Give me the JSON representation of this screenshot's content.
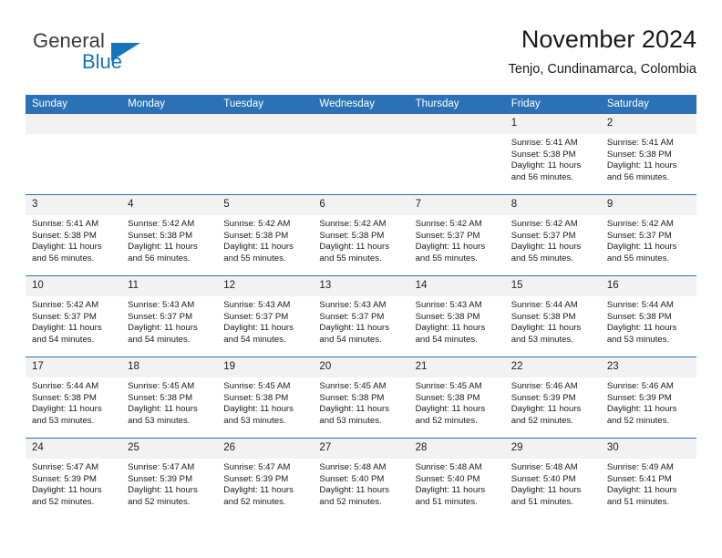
{
  "brand": {
    "name_top": "General",
    "name_bottom": "Blue",
    "triangle_color": "#1574bb"
  },
  "header": {
    "title": "November 2024",
    "subtitle": "Tenjo, Cundinamarca, Colombia"
  },
  "theme": {
    "header_blue": "#2a72b5",
    "daynum_gray": "#f2f2f2",
    "brand_blue": "#1574bb"
  },
  "calendar": {
    "weekday_headers": [
      "Sunday",
      "Monday",
      "Tuesday",
      "Wednesday",
      "Thursday",
      "Friday",
      "Saturday"
    ],
    "weeks": [
      [
        {
          "day": "",
          "blank": true
        },
        {
          "day": "",
          "blank": true
        },
        {
          "day": "",
          "blank": true
        },
        {
          "day": "",
          "blank": true
        },
        {
          "day": "",
          "blank": true
        },
        {
          "day": "1",
          "sunrise": "Sunrise: 5:41 AM",
          "sunset": "Sunset: 5:38 PM",
          "daylight": "Daylight: 11 hours and 56 minutes."
        },
        {
          "day": "2",
          "sunrise": "Sunrise: 5:41 AM",
          "sunset": "Sunset: 5:38 PM",
          "daylight": "Daylight: 11 hours and 56 minutes."
        }
      ],
      [
        {
          "day": "3",
          "sunrise": "Sunrise: 5:41 AM",
          "sunset": "Sunset: 5:38 PM",
          "daylight": "Daylight: 11 hours and 56 minutes."
        },
        {
          "day": "4",
          "sunrise": "Sunrise: 5:42 AM",
          "sunset": "Sunset: 5:38 PM",
          "daylight": "Daylight: 11 hours and 56 minutes."
        },
        {
          "day": "5",
          "sunrise": "Sunrise: 5:42 AM",
          "sunset": "Sunset: 5:38 PM",
          "daylight": "Daylight: 11 hours and 55 minutes."
        },
        {
          "day": "6",
          "sunrise": "Sunrise: 5:42 AM",
          "sunset": "Sunset: 5:38 PM",
          "daylight": "Daylight: 11 hours and 55 minutes."
        },
        {
          "day": "7",
          "sunrise": "Sunrise: 5:42 AM",
          "sunset": "Sunset: 5:37 PM",
          "daylight": "Daylight: 11 hours and 55 minutes."
        },
        {
          "day": "8",
          "sunrise": "Sunrise: 5:42 AM",
          "sunset": "Sunset: 5:37 PM",
          "daylight": "Daylight: 11 hours and 55 minutes."
        },
        {
          "day": "9",
          "sunrise": "Sunrise: 5:42 AM",
          "sunset": "Sunset: 5:37 PM",
          "daylight": "Daylight: 11 hours and 55 minutes."
        }
      ],
      [
        {
          "day": "10",
          "sunrise": "Sunrise: 5:42 AM",
          "sunset": "Sunset: 5:37 PM",
          "daylight": "Daylight: 11 hours and 54 minutes."
        },
        {
          "day": "11",
          "sunrise": "Sunrise: 5:43 AM",
          "sunset": "Sunset: 5:37 PM",
          "daylight": "Daylight: 11 hours and 54 minutes."
        },
        {
          "day": "12",
          "sunrise": "Sunrise: 5:43 AM",
          "sunset": "Sunset: 5:37 PM",
          "daylight": "Daylight: 11 hours and 54 minutes."
        },
        {
          "day": "13",
          "sunrise": "Sunrise: 5:43 AM",
          "sunset": "Sunset: 5:37 PM",
          "daylight": "Daylight: 11 hours and 54 minutes."
        },
        {
          "day": "14",
          "sunrise": "Sunrise: 5:43 AM",
          "sunset": "Sunset: 5:38 PM",
          "daylight": "Daylight: 11 hours and 54 minutes."
        },
        {
          "day": "15",
          "sunrise": "Sunrise: 5:44 AM",
          "sunset": "Sunset: 5:38 PM",
          "daylight": "Daylight: 11 hours and 53 minutes."
        },
        {
          "day": "16",
          "sunrise": "Sunrise: 5:44 AM",
          "sunset": "Sunset: 5:38 PM",
          "daylight": "Daylight: 11 hours and 53 minutes."
        }
      ],
      [
        {
          "day": "17",
          "sunrise": "Sunrise: 5:44 AM",
          "sunset": "Sunset: 5:38 PM",
          "daylight": "Daylight: 11 hours and 53 minutes."
        },
        {
          "day": "18",
          "sunrise": "Sunrise: 5:45 AM",
          "sunset": "Sunset: 5:38 PM",
          "daylight": "Daylight: 11 hours and 53 minutes."
        },
        {
          "day": "19",
          "sunrise": "Sunrise: 5:45 AM",
          "sunset": "Sunset: 5:38 PM",
          "daylight": "Daylight: 11 hours and 53 minutes."
        },
        {
          "day": "20",
          "sunrise": "Sunrise: 5:45 AM",
          "sunset": "Sunset: 5:38 PM",
          "daylight": "Daylight: 11 hours and 53 minutes."
        },
        {
          "day": "21",
          "sunrise": "Sunrise: 5:45 AM",
          "sunset": "Sunset: 5:38 PM",
          "daylight": "Daylight: 11 hours and 52 minutes."
        },
        {
          "day": "22",
          "sunrise": "Sunrise: 5:46 AM",
          "sunset": "Sunset: 5:39 PM",
          "daylight": "Daylight: 11 hours and 52 minutes."
        },
        {
          "day": "23",
          "sunrise": "Sunrise: 5:46 AM",
          "sunset": "Sunset: 5:39 PM",
          "daylight": "Daylight: 11 hours and 52 minutes."
        }
      ],
      [
        {
          "day": "24",
          "sunrise": "Sunrise: 5:47 AM",
          "sunset": "Sunset: 5:39 PM",
          "daylight": "Daylight: 11 hours and 52 minutes."
        },
        {
          "day": "25",
          "sunrise": "Sunrise: 5:47 AM",
          "sunset": "Sunset: 5:39 PM",
          "daylight": "Daylight: 11 hours and 52 minutes."
        },
        {
          "day": "26",
          "sunrise": "Sunrise: 5:47 AM",
          "sunset": "Sunset: 5:39 PM",
          "daylight": "Daylight: 11 hours and 52 minutes."
        },
        {
          "day": "27",
          "sunrise": "Sunrise: 5:48 AM",
          "sunset": "Sunset: 5:40 PM",
          "daylight": "Daylight: 11 hours and 52 minutes."
        },
        {
          "day": "28",
          "sunrise": "Sunrise: 5:48 AM",
          "sunset": "Sunset: 5:40 PM",
          "daylight": "Daylight: 11 hours and 51 minutes."
        },
        {
          "day": "29",
          "sunrise": "Sunrise: 5:48 AM",
          "sunset": "Sunset: 5:40 PM",
          "daylight": "Daylight: 11 hours and 51 minutes."
        },
        {
          "day": "30",
          "sunrise": "Sunrise: 5:49 AM",
          "sunset": "Sunset: 5:41 PM",
          "daylight": "Daylight: 11 hours and 51 minutes."
        }
      ]
    ]
  }
}
